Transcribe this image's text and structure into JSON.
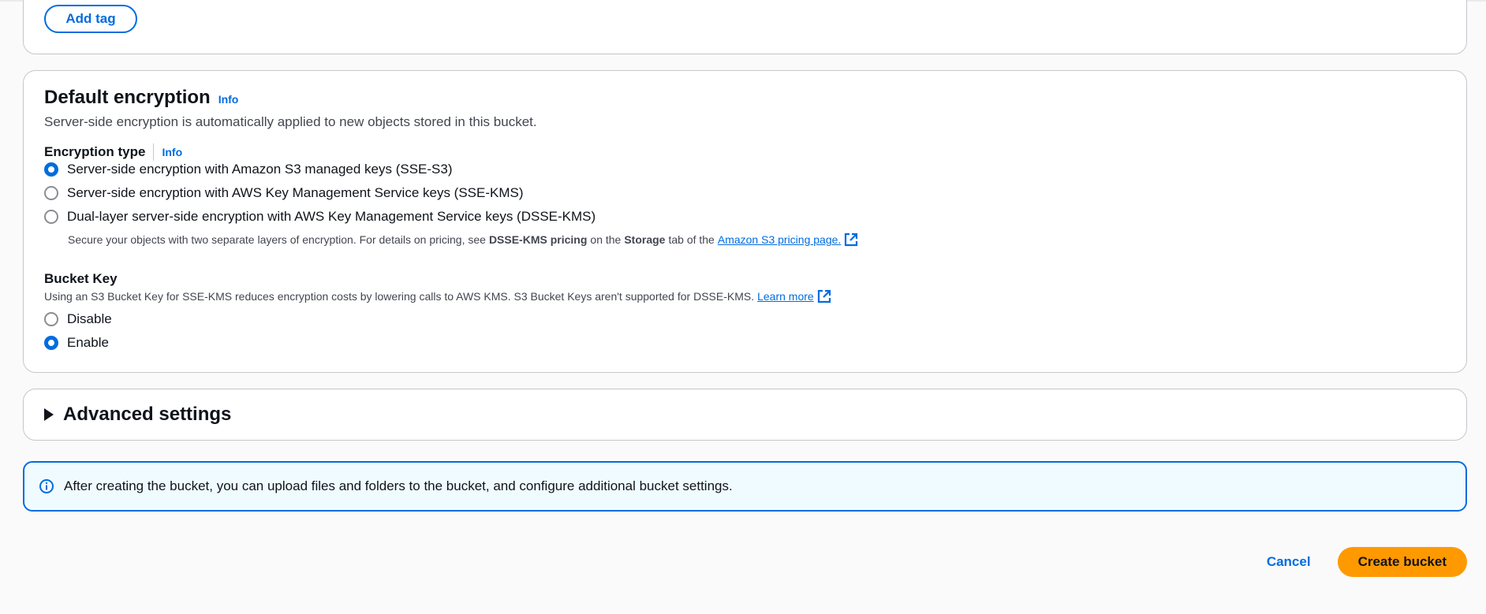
{
  "tags": {
    "add_tag_label": "Add tag"
  },
  "encryption": {
    "title": "Default encryption",
    "info": "Info",
    "description": "Server-side encryption is automatically applied to new objects stored in this bucket.",
    "type_label": "Encryption type",
    "type_info": "Info",
    "options": [
      {
        "label": "Server-side encryption with Amazon S3 managed keys (SSE-S3)",
        "checked": true
      },
      {
        "label": "Server-side encryption with AWS Key Management Service keys (SSE-KMS)",
        "checked": false
      },
      {
        "label": "Dual-layer server-side encryption with AWS Key Management Service keys (DSSE-KMS)",
        "checked": false
      }
    ],
    "dsse_desc": {
      "part1": "Secure your objects with two separate layers of encryption. For details on pricing, see",
      "bold1": "DSSE-KMS pricing",
      "part2": "on the",
      "bold2": "Storage",
      "part3": "tab of the",
      "link": "Amazon S3 pricing page."
    },
    "bucket_key": {
      "label": "Bucket Key",
      "description": "Using an S3 Bucket Key for SSE-KMS reduces encryption costs by lowering calls to AWS KMS. S3 Bucket Keys aren't supported for DSSE-KMS.",
      "learn_more": "Learn more",
      "options": [
        {
          "label": "Disable",
          "checked": false
        },
        {
          "label": "Enable",
          "checked": true
        }
      ]
    }
  },
  "advanced": {
    "label": "Advanced settings"
  },
  "alert": {
    "text": "After creating the bucket, you can upload files and folders to the bucket, and configure additional bucket settings."
  },
  "actions": {
    "cancel": "Cancel",
    "create": "Create bucket"
  },
  "colors": {
    "accent": "#006ce0",
    "primary": "#ff9900",
    "alert_bg": "#f0fbff"
  }
}
